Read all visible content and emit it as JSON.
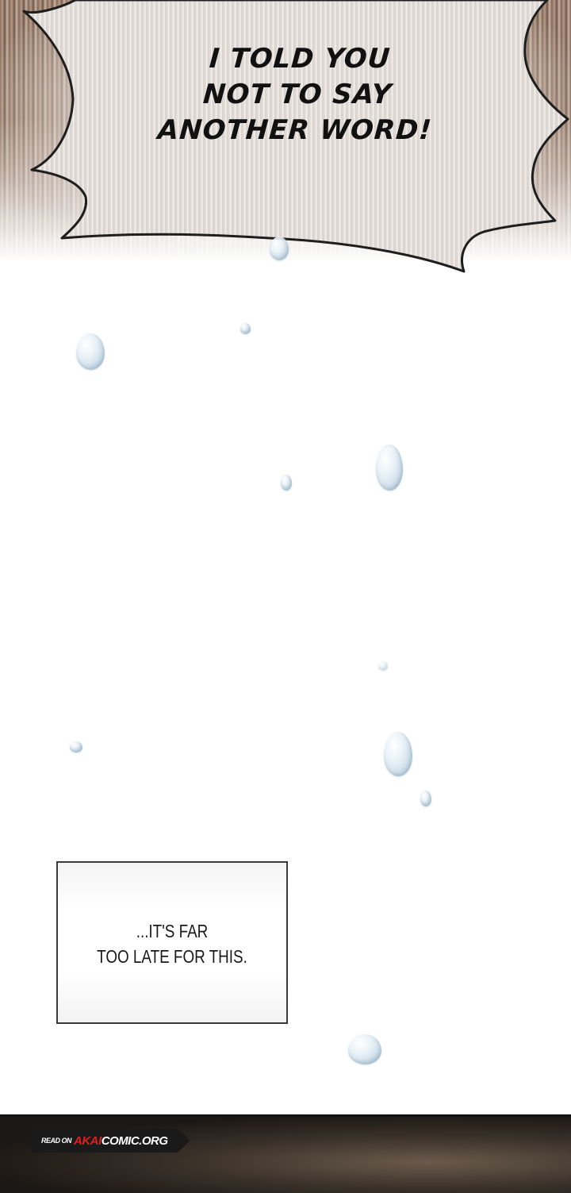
{
  "panels": {
    "shout": {
      "text": "I TOLD YOU\nNOT TO SAY\nANOTHER WORD!"
    },
    "narration": {
      "text": "...IT'S FAR\nTOO LATE FOR THIS."
    }
  },
  "watermark": {
    "prefix": "READ ON",
    "brand": "AKAI",
    "domain": "COMIC.ORG"
  },
  "colors": {
    "background": "#ffffff",
    "brand_red": "#e02020",
    "banner_dark": "#1a1a1a"
  }
}
